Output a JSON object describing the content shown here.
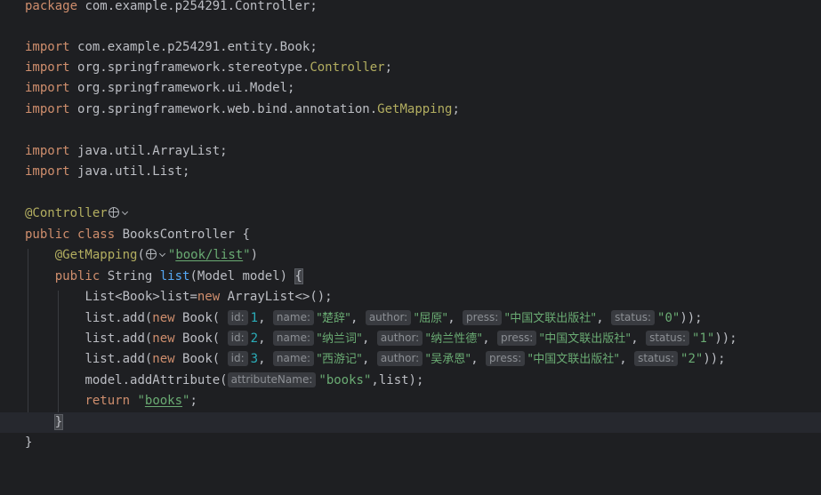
{
  "editor": {
    "package_kw": "package",
    "package_name": "com.example.p254291.Controller",
    "import_kw": "import",
    "imports_a": [
      {
        "path": "com.example.p254291.entity.Book",
        "tail": ""
      },
      {
        "path": "org.springframework.stereotype.",
        "tail": "Controller"
      },
      {
        "path": "org.springframework.ui.Model",
        "tail": ""
      },
      {
        "path": "org.springframework.web.bind.annotation.",
        "tail": "GetMapping"
      }
    ],
    "imports_b": [
      {
        "path": "java.util.ArrayList",
        "tail": ""
      },
      {
        "path": "java.util.List",
        "tail": ""
      }
    ],
    "class_annotation": "@Controller",
    "public_kw": "public",
    "class_kw": "class",
    "class_name": "BooksController",
    "method_annotation": "@GetMapping",
    "mapping_path": "book/list",
    "return_type": "String",
    "method_name": "list",
    "param_type": "Model",
    "param_name": "model",
    "list_decl_left": "List<Book>list=",
    "new_kw": "new",
    "list_decl_right": "ArrayList<>();",
    "list_add": "list.add(",
    "book_class": "Book(",
    "hint_id": "id:",
    "hint_name": "name:",
    "hint_author": "author:",
    "hint_press": "press:",
    "hint_status": "status:",
    "books": [
      {
        "id": "1",
        "name": "\"楚辞\"",
        "author": "\"屈原\"",
        "press": "\"中国文联出版社\"",
        "status": "\"0\""
      },
      {
        "id": "2",
        "name": "\"纳兰词\"",
        "author": "\"纳兰性德\"",
        "press": "\"中国文联出版社\"",
        "status": "\"1\""
      },
      {
        "id": "3",
        "name": "\"西游记\"",
        "author": "\"吴承恩\"",
        "press": "\"中国文联出版社\"",
        "status": "\"2\""
      }
    ],
    "model_call": "model.addAttribute(",
    "hint_attribute_name": "attributeName:",
    "attr_key": "\"books\"",
    "attr_value": ",list);",
    "return_kw": "return",
    "return_value": "books"
  }
}
